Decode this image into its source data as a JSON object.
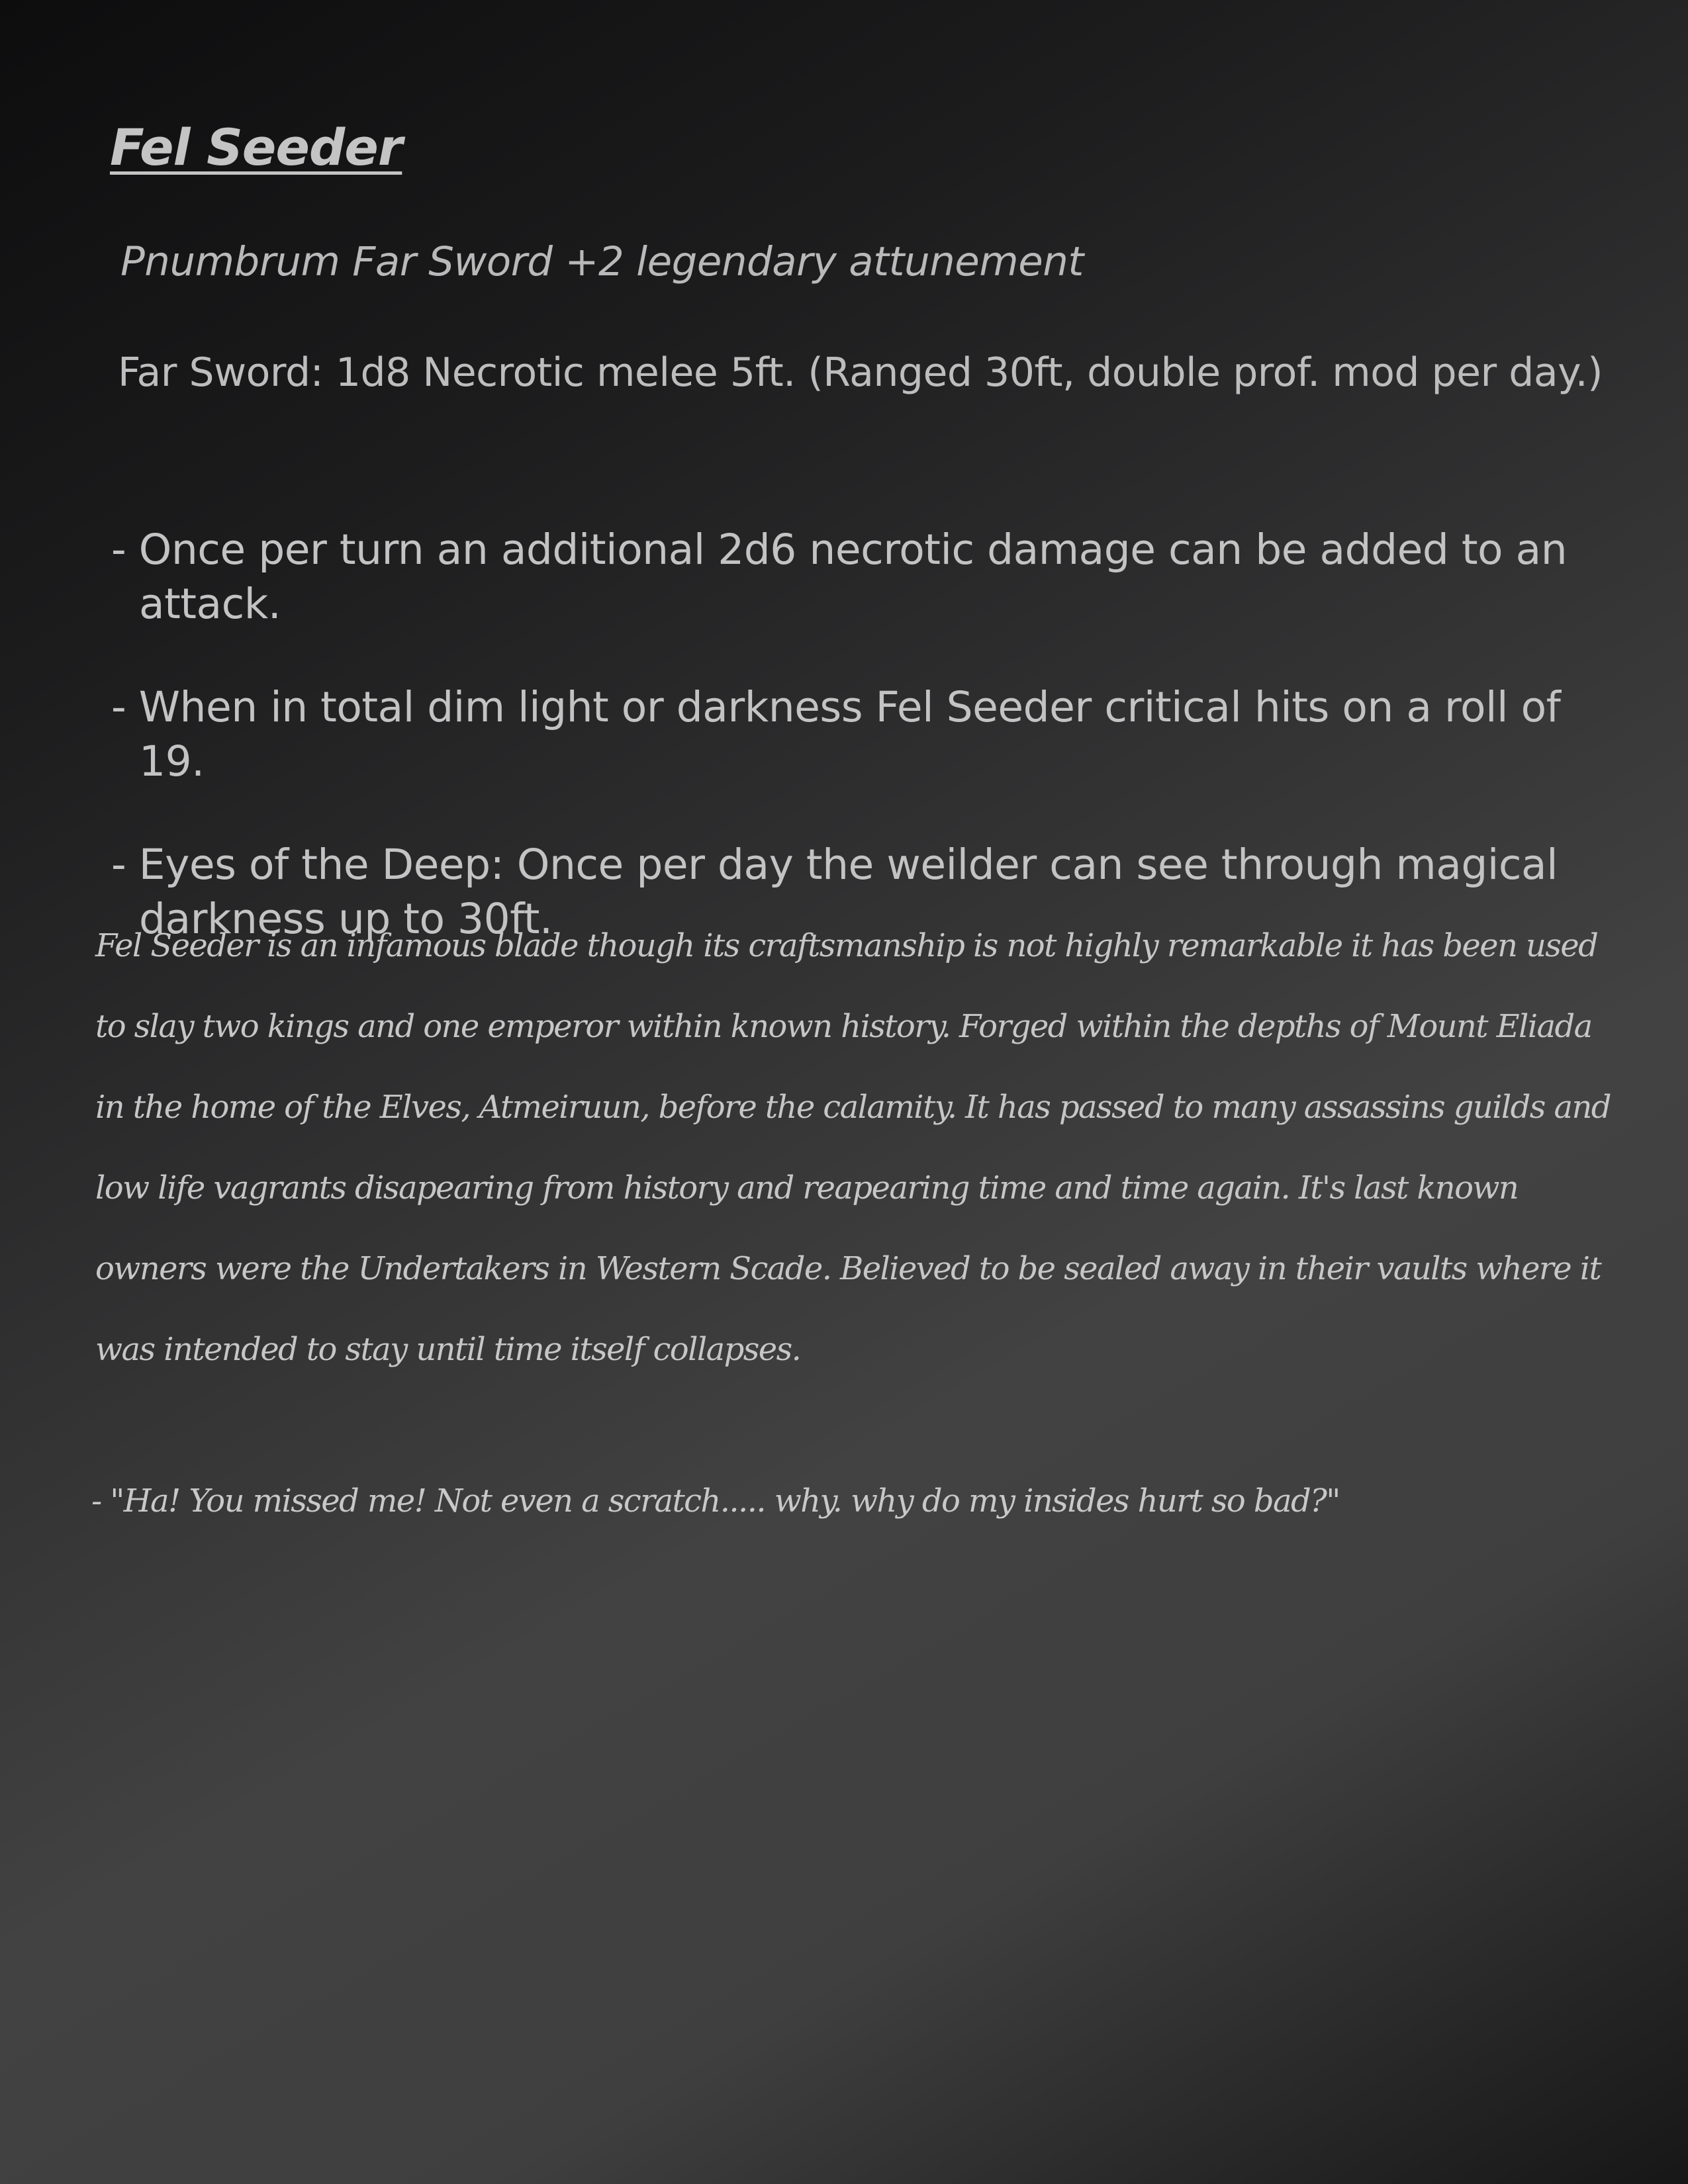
{
  "item": {
    "title": "Fel Seeder",
    "subtitle": "Pnumbrum Far Sword +2 legendary attunement",
    "stat_line": "Far Sword: 1d8 Necrotic melee 5ft. (Ranged 30ft, double prof. mod per day.)",
    "features": [
      "- Once per turn an additional 2d6 necrotic damage can be added to an attack.",
      "- When in total dim light or darkness Fel Seeder critical hits on a roll of 19.",
      "- Eyes of the Deep: Once per day the weilder can see through magical darkness up to 30ft."
    ],
    "lore": "Fel Seeder is an infamous blade though its craftsmanship is not highly remarkable it has been used to slay two kings and one emperor within known history. Forged within the depths of Mount Eliada in the home of the Elves, Atmeiruun, before the calamity. It has passed to many assassins guilds and low life vagrants disapearing from history and reapearing time and time again. It's last known owners were the Undertakers in Western Scade. Believed to be sealed away in their vaults where it was intended to stay until time itself collapses.",
    "quote": "- \"Ha! You missed me! Not even a scratch..... why. why do my insides hurt so bad?\""
  }
}
